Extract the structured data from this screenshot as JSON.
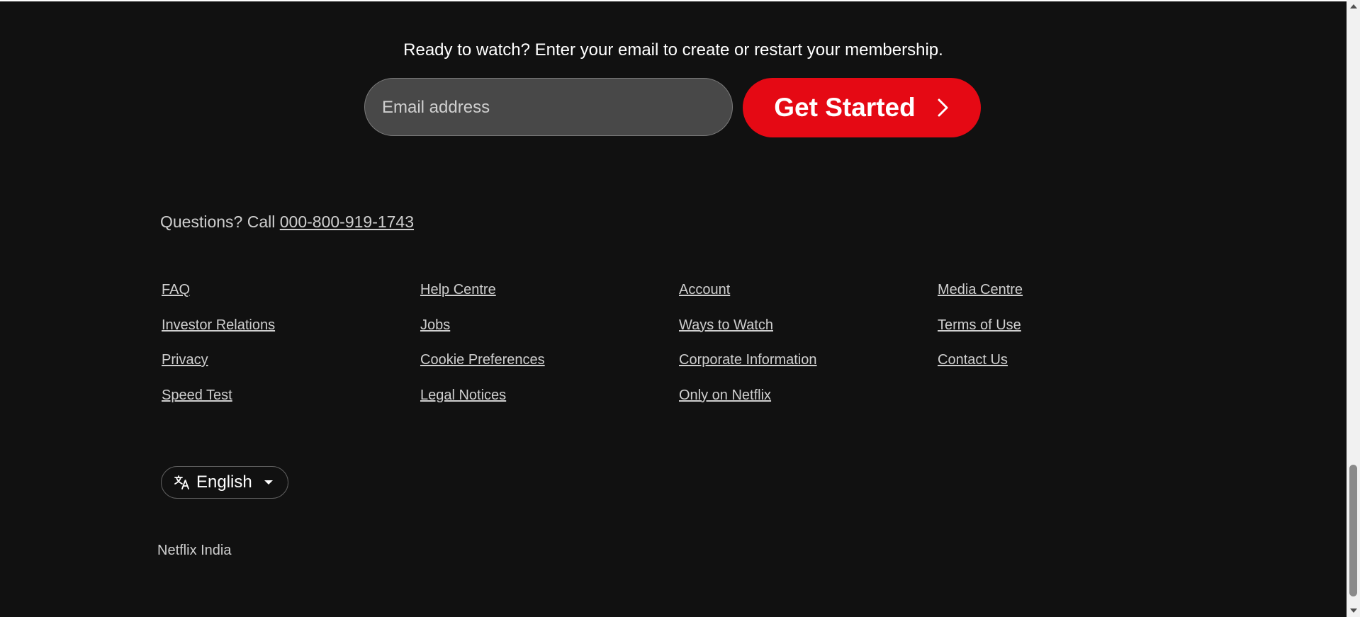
{
  "cta": {
    "text": "Ready to watch? Enter your email to create or restart your membership.",
    "email_placeholder": "Email address",
    "button_label": "Get Started"
  },
  "questions": {
    "prefix": "Questions? Call ",
    "phone": "000-800-919-1743"
  },
  "footer_columns": [
    [
      "FAQ",
      "Investor Relations",
      "Privacy",
      "Speed Test"
    ],
    [
      "Help Centre",
      "Jobs",
      "Cookie Preferences",
      "Legal Notices"
    ],
    [
      "Account",
      "Ways to Watch",
      "Corporate Information",
      "Only on Netflix"
    ],
    [
      "Media Centre",
      "Terms of Use",
      "Contact Us"
    ]
  ],
  "language": {
    "selected": "English",
    "icon": "translate-icon"
  },
  "country": "Netflix India",
  "colors": {
    "background": "#111111",
    "accent": "#e50914",
    "link": "#cfcfcf"
  }
}
